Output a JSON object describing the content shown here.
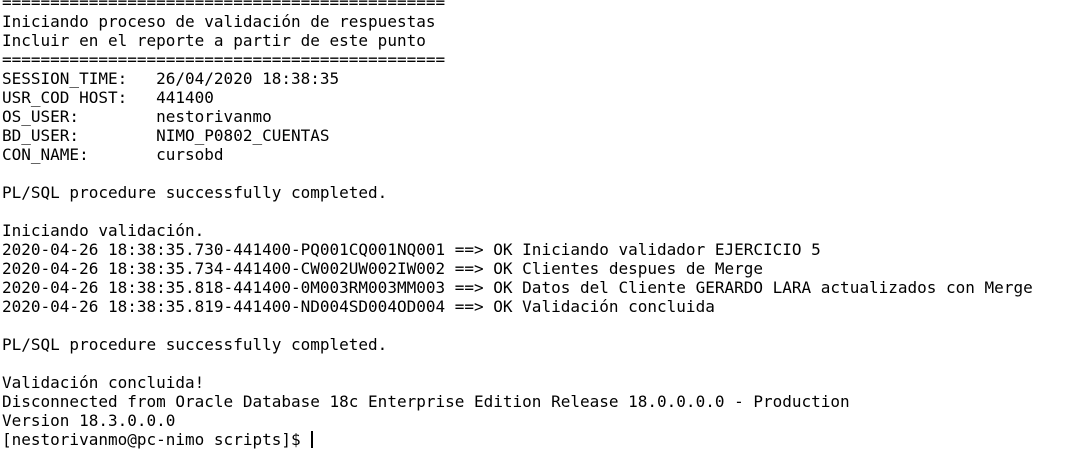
{
  "terminal": {
    "lines": [
      "==============================================",
      "Iniciando proceso de validación de respuestas",
      "Incluir en el reporte a partir de este punto",
      "==============================================",
      "SESSION_TIME:   26/04/2020 18:38:35",
      "USR_COD HOST:   441400",
      "OS_USER:        nestorivanmo",
      "BD_USER:        NIMO_P0802_CUENTAS",
      "CON_NAME:       cursobd",
      "",
      "PL/SQL procedure successfully completed.",
      "",
      "Iniciando validación.",
      "2020-04-26 18:38:35.730-441400-PQ001CQ001NQ001 ==> OK Iniciando validador EJERCICIO 5",
      "2020-04-26 18:38:35.734-441400-CW002UW002IW002 ==> OK Clientes despues de Merge",
      "2020-04-26 18:38:35.818-441400-0M003RM003MM003 ==> OK Datos del Cliente GERARDO LARA actualizados con Merge",
      "2020-04-26 18:38:35.819-441400-ND004SD004OD004 ==> OK Validación concluida",
      "",
      "PL/SQL procedure successfully completed.",
      "",
      "Validación concluida!",
      "Disconnected from Oracle Database 18c Enterprise Edition Release 18.0.0.0.0 - Production",
      "Version 18.3.0.0.0"
    ],
    "prompt": "[nestorivanmo@pc-nimo scripts]$ "
  }
}
